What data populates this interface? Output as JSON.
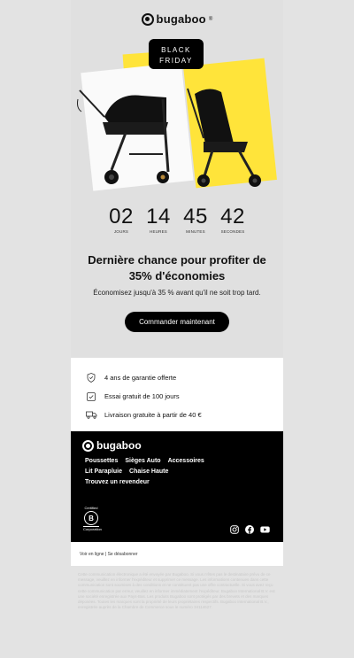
{
  "brand": {
    "name": "bugaboo",
    "mark": "®"
  },
  "promo": {
    "line1": "BLACK",
    "line2": "FRIDAY"
  },
  "countdown": [
    {
      "value": "02",
      "label": "JOURS"
    },
    {
      "value": "14",
      "label": "HEURES"
    },
    {
      "value": "45",
      "label": "MINUTES"
    },
    {
      "value": "42",
      "label": "SECONDES"
    }
  ],
  "headline": "Dernière chance pour profiter de 35% d'économies",
  "subline": "Économisez jusqu'à 35 % avant qu'il ne soit trop tard.",
  "cta": "Commander maintenant",
  "benefits": [
    {
      "icon": "shield-check-icon",
      "text": "4 ans de garantie offerte"
    },
    {
      "icon": "checkbox-icon",
      "text": "Essai gratuit de 100 jours"
    },
    {
      "icon": "truck-icon",
      "text": "Livraison gratuite à partir de 40 €"
    }
  ],
  "footer": {
    "nav": [
      "Poussettes",
      "Sièges Auto",
      "Accessoires",
      "Lit Parapluie",
      "Chaise Haute",
      "Trouvez un revendeur"
    ],
    "bcorp_label": "Certified",
    "bcorp_letter": "B",
    "bcorp_sub": "Corporation",
    "links": "Voir en ligne | Se désabonner"
  },
  "legal": "Cette communication électronique a été envoyée par Bugaboo. Si vous n'êtes pas le destinataire prévu de ce message, veuillez en informer l'expéditeur et supprimer ce message. Les informations contenues dans cette communication sont soumises à des conditions et ne constituent pas une offre contractuelle. Si vous avez reçu cette communication par erreur, veuillez en informer immédiatement l'expéditeur. Bugaboo International B.V. est une société enregistrée aux Pays-Bas. Les produits Bugaboo sont protégés par des brevets et des marques déposées. Toutes les marques sont la propriété de leurs propriétaires respectifs. Bugaboo International B.V., enregistrée auprès de la Chambre de Commerce sous le numéro 34114627.",
  "colors": {
    "accent": "#ffe43a",
    "dark": "#000000",
    "hero_bg": "#e0e0e0"
  }
}
